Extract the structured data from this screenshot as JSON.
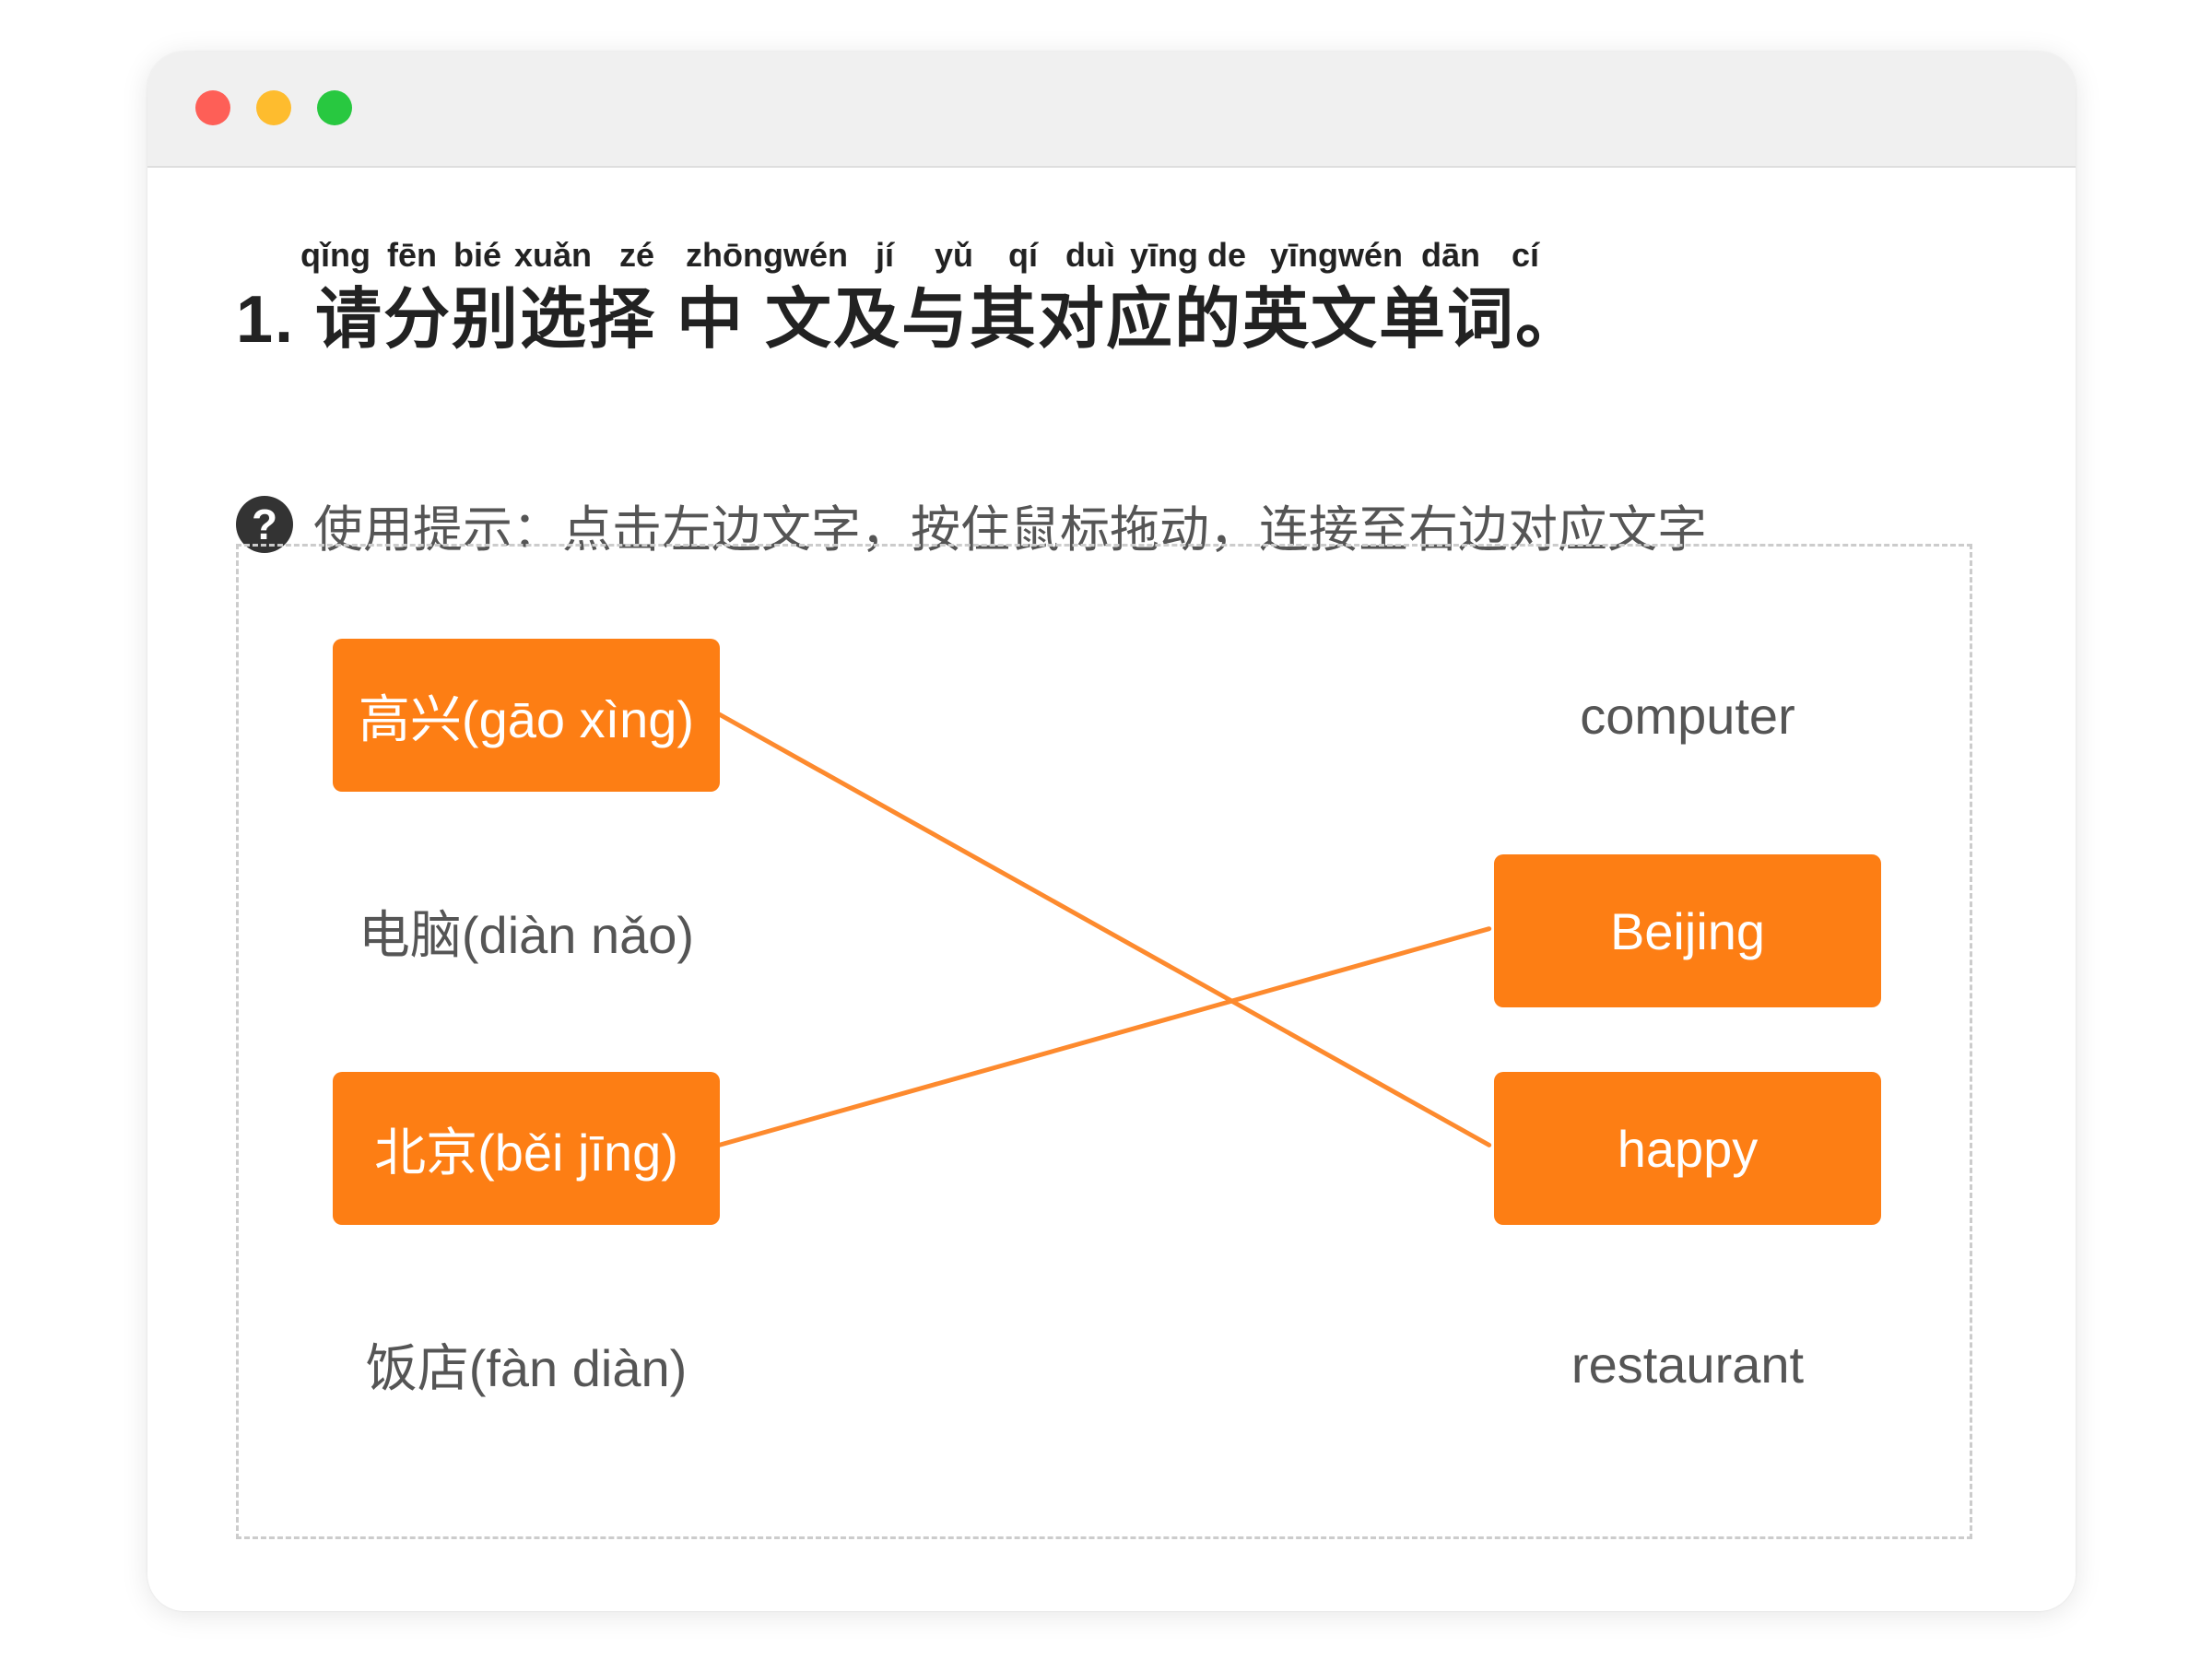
{
  "window": {
    "controls": [
      "close-dot",
      "minimize-dot",
      "maximize-dot"
    ],
    "colors": {
      "close": "#fe5f57",
      "minimize": "#febc2e",
      "maximize": "#28c840"
    }
  },
  "question": {
    "pinyin": [
      "qǐng",
      "fēn",
      "bié",
      "xuǎn",
      "zé",
      "zhōngwén",
      "jí",
      "yǔ",
      "qí",
      "duì",
      "yīng",
      "de",
      "yīngwén",
      "dān",
      "cí"
    ],
    "title": "1. 请分别选择 中 文及与其对应的英文单词。"
  },
  "hint": {
    "icon": "question-circle-icon",
    "text": "使用提示：点击左边文字，按住鼠标拖动，连接至右边对应文字"
  },
  "matching": {
    "accent_color": "#fd7e14",
    "line_color": "#fd8a2e",
    "left_items": [
      {
        "label": "高兴(gāo xìng)",
        "selected": true
      },
      {
        "label": "电脑(diàn nǎo)",
        "selected": false
      },
      {
        "label": "北京(běi jīng)",
        "selected": true
      },
      {
        "label": "饭店(fàn diàn)",
        "selected": false
      }
    ],
    "right_items": [
      {
        "label": "computer",
        "selected": false
      },
      {
        "label": "Beijing",
        "selected": true
      },
      {
        "label": "happy",
        "selected": true
      },
      {
        "label": "restaurant",
        "selected": false
      }
    ],
    "connections": [
      {
        "from": "高兴(gāo xìng)",
        "to": "happy"
      },
      {
        "from": "北京(běi jīng)",
        "to": "Beijing"
      }
    ]
  }
}
